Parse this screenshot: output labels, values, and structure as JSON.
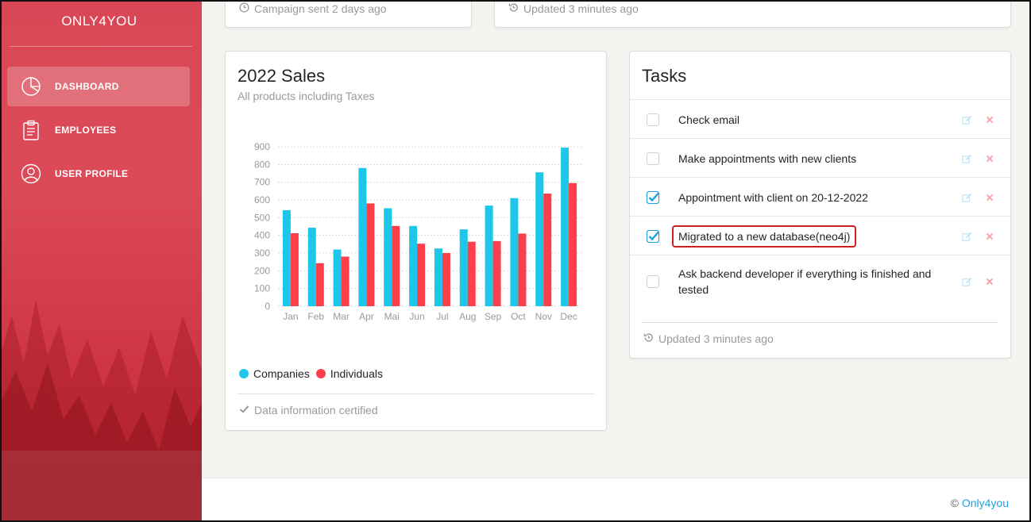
{
  "brand": "ONLY4YOU",
  "nav": [
    {
      "label": "DASHBOARD",
      "icon": "pie-chart-icon",
      "active": true
    },
    {
      "label": "EMPLOYEES",
      "icon": "clipboard-icon",
      "active": false
    },
    {
      "label": "USER PROFILE",
      "icon": "user-icon",
      "active": false
    }
  ],
  "top_cards": {
    "left_footer": "Campaign sent 2 days ago",
    "right_footer": "Updated 3 minutes ago"
  },
  "sales": {
    "title": "2022 Sales",
    "subtitle": "All products including Taxes",
    "footer": "Data information certified"
  },
  "chart_data": {
    "type": "bar",
    "categories": [
      "Jan",
      "Feb",
      "Mar",
      "Apr",
      "Mai",
      "Jun",
      "Jul",
      "Aug",
      "Sep",
      "Oct",
      "Nov",
      "Dec"
    ],
    "series": [
      {
        "name": "Companies",
        "color": "#1dc7ea",
        "values": [
          542,
          443,
          320,
          780,
          553,
          453,
          326,
          434,
          568,
          610,
          756,
          895
        ]
      },
      {
        "name": "Individuals",
        "color": "#fb404b",
        "values": [
          412,
          243,
          280,
          580,
          453,
          353,
          300,
          364,
          368,
          410,
          636,
          695
        ]
      }
    ],
    "yticks": [
      0,
      100,
      200,
      300,
      400,
      500,
      600,
      700,
      800,
      900
    ],
    "ylim": [
      0,
      900
    ],
    "grid": true,
    "legend_position": "bottom-left"
  },
  "tasks": {
    "title": "Tasks",
    "items": [
      {
        "text": "Check email",
        "checked": false
      },
      {
        "text": "Make appointments with new clients",
        "checked": false
      },
      {
        "text": "Appointment with client on 20-12-2022",
        "checked": true
      },
      {
        "text": "Migrated to a new database(neo4j)",
        "checked": true
      },
      {
        "text": "Ask backend developer if everything is finished and tested",
        "checked": false
      }
    ],
    "footer": "Updated 3 minutes ago"
  },
  "footer": {
    "copyright_symbol": "©",
    "link": "Only4you"
  },
  "colors": {
    "accent_blue": "#1dc7ea",
    "accent_red": "#fb404b",
    "sidebar": "#d94756",
    "highlight_box": "#cc1f1f"
  }
}
